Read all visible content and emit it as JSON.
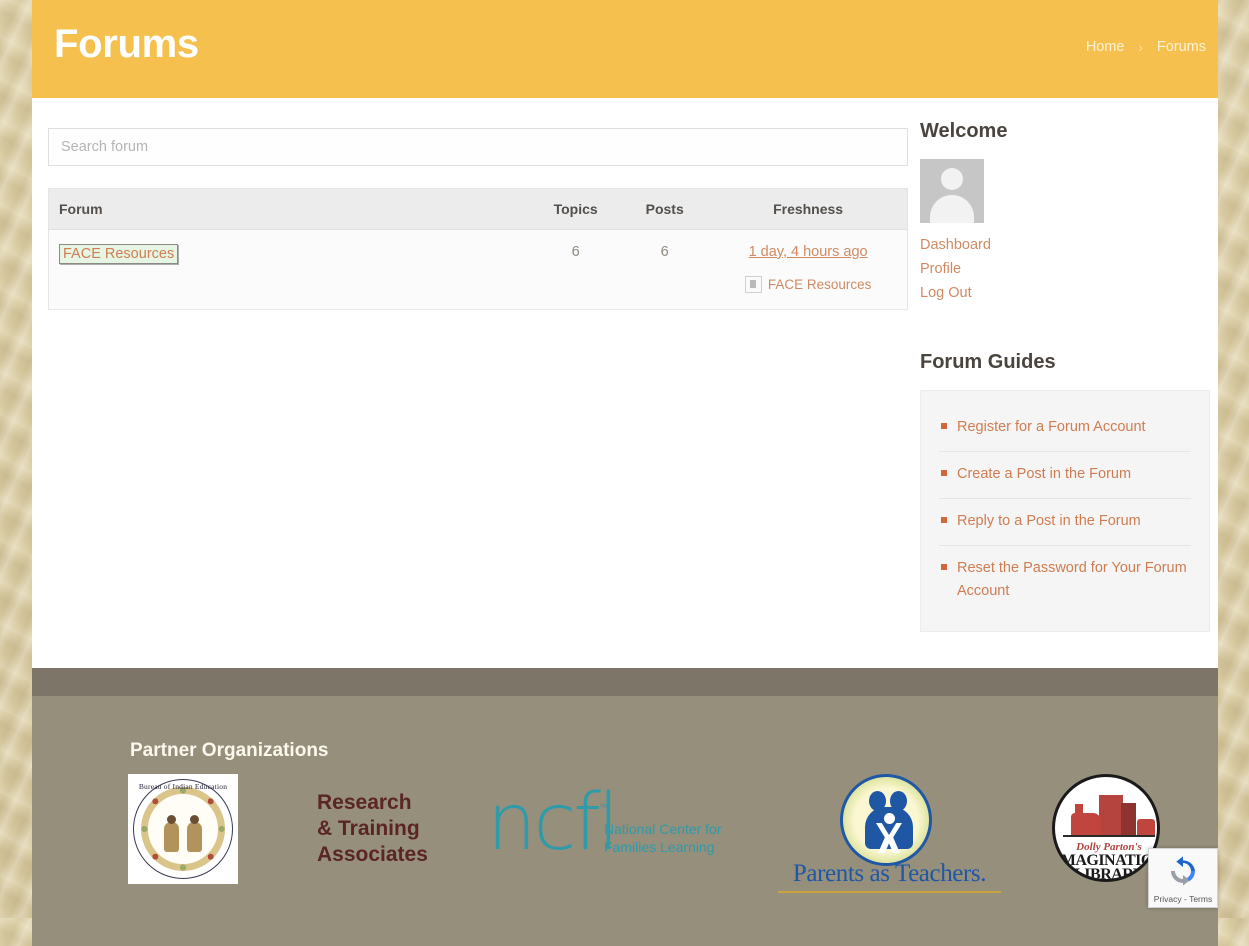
{
  "header": {
    "title": "Forums",
    "breadcrumb": {
      "home": "Home",
      "separator": "›",
      "current": "Forums"
    }
  },
  "search": {
    "placeholder": "Search forum",
    "value": ""
  },
  "forum_table": {
    "columns": {
      "forum": "Forum",
      "topics": "Topics",
      "posts": "Posts",
      "freshness": "Freshness"
    },
    "rows": [
      {
        "forum": "FACE Resources",
        "topics": "6",
        "posts": "6",
        "freshness_time": "1 day, 4 hours ago",
        "freshness_author": "FACE Resources"
      }
    ]
  },
  "sidebar": {
    "welcome": {
      "title": "Welcome",
      "links": [
        {
          "label": "Dashboard"
        },
        {
          "label": "Profile"
        },
        {
          "label": "Log Out"
        }
      ]
    },
    "guides": {
      "title": "Forum Guides",
      "items": [
        {
          "label": "Register for a Forum Account"
        },
        {
          "label": "Create a Post in the Forum"
        },
        {
          "label": "Reply to a Post in the Forum"
        },
        {
          "label": "Reset the Password for Your Forum Account"
        }
      ]
    }
  },
  "footer": {
    "heading": "Partner Organizations",
    "partners": {
      "bie": "Bureau of Indian Education",
      "rta_line1": "Research",
      "rta_line2": "& Training",
      "rta_line3": "Associates",
      "ncfl_mark": "ncfl",
      "ncfl_tm": "™",
      "ncfl_sub_line1": "National Center for",
      "ncfl_sub_line2": "Families Learning",
      "pat_text": "Parents as Teachers.",
      "dpil_dolly": "Dolly Parton's",
      "dpil_imagination": "IMAGINATION",
      "dpil_library": "LIBRARY"
    }
  },
  "recaptcha": {
    "text": "Privacy - Terms"
  },
  "colors": {
    "header_yellow": "#f5c04e",
    "link_orange": "#cf7d52",
    "bullet_orange": "#d1663a",
    "footer_band": "#7d7668",
    "footer_bg": "#958f7c",
    "page_bg": "#d8caa0"
  }
}
